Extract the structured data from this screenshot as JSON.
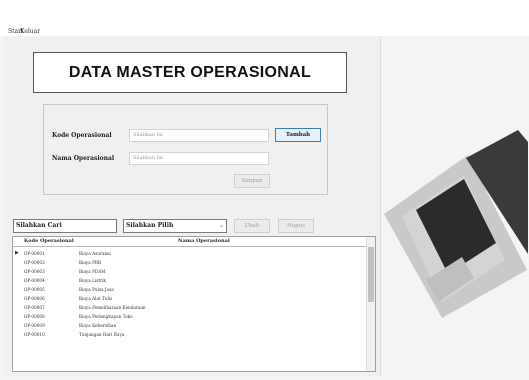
{
  "menu": [
    "Start",
    "Keluar"
  ],
  "title": "DATA MASTER OPERASIONAL",
  "form": {
    "kode_label": "Kode Operasional",
    "kode_placeholder": "Silahkan Isi",
    "nama_label": "Nama Operasional",
    "nama_placeholder": "Silahkan Isi",
    "tambah_label": "Tambah",
    "simpan_label": "Simpan"
  },
  "search": {
    "cari_value": "Silahkan Cari",
    "pilih_value": "Silahkan Pilih",
    "ubah_label": "Ubah",
    "hapus_label": "Hapus"
  },
  "table": {
    "headers": [
      "Kode Operasional",
      "Nama Operasional"
    ],
    "rows": [
      [
        "OP-00001",
        "Biaya Asuransi"
      ],
      [
        "OP-00002",
        "Biaya PBB"
      ],
      [
        "OP-00003",
        "Biaya PDAM"
      ],
      [
        "OP-00004",
        "Biaya Listrik"
      ],
      [
        "OP-00005",
        "Biaya Pulsa Jasa"
      ],
      [
        "OP-00006",
        "Biaya Alat Tulis"
      ],
      [
        "OP-00007",
        "Biaya Pemeliharaan Kendaraan"
      ],
      [
        "OP-00008",
        "Biaya Perlengkapan Toko"
      ],
      [
        "OP-00009",
        "Biaya Kebersihan"
      ],
      [
        "OP-00010",
        "Tunjangan Hari Raya"
      ]
    ]
  },
  "colors": {
    "accent": "#3c7fb1",
    "window_bg": "#f0f0f0"
  },
  "icons": [
    "row-selector-icon",
    "dropdown-chevron-icon",
    "laptop-image"
  ]
}
